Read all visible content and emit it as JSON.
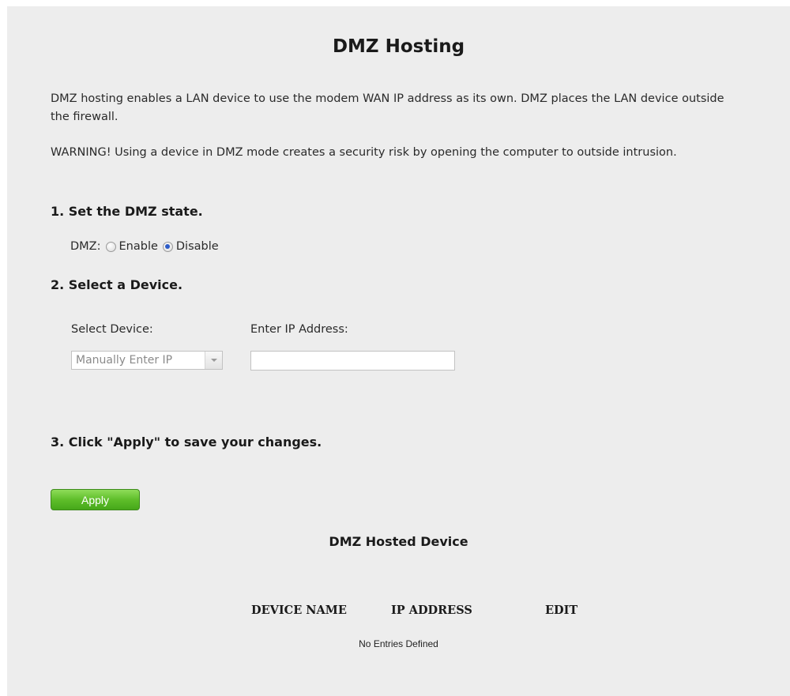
{
  "page": {
    "title": "DMZ Hosting",
    "description": "DMZ hosting enables a LAN device to use the modem WAN IP address as its own. DMZ places the LAN device outside the firewall.",
    "warning": "WARNING! Using a device in DMZ mode creates a security risk by opening the computer to outside intrusion."
  },
  "step1": {
    "heading": "1. Set the DMZ state.",
    "dmz_label": "DMZ:",
    "options": [
      "Enable",
      "Disable"
    ],
    "selected": "Disable"
  },
  "step2": {
    "heading": "2. Select a Device.",
    "select_label": "Select Device:",
    "select_value": "Manually Enter IP",
    "ip_label": "Enter IP Address:",
    "ip_value": ""
  },
  "step3": {
    "heading": "3. Click \"Apply\" to save your changes.",
    "apply_label": "Apply"
  },
  "hosted": {
    "title": "DMZ Hosted Device",
    "columns": [
      "DEVICE NAME",
      "IP ADDRESS",
      "EDIT"
    ],
    "empty_text": "No Entries Defined"
  },
  "colors": {
    "panel_bg": "#ededed",
    "apply_green": "#5fbe2a",
    "radio_selected": "#2d5cc8"
  }
}
